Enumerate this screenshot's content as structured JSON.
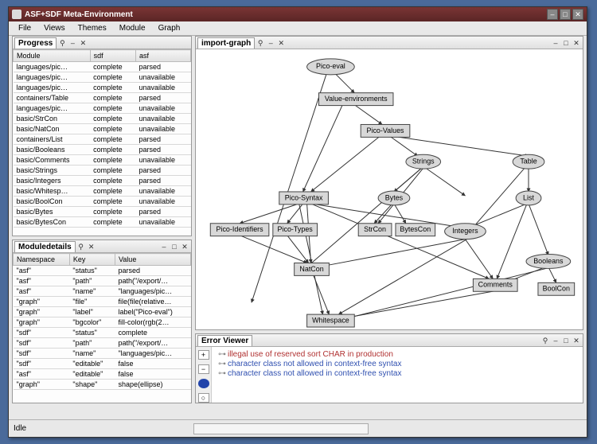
{
  "window": {
    "title": "ASF+SDF Meta-Environment"
  },
  "menu": [
    "File",
    "Views",
    "Themes",
    "Module",
    "Graph"
  ],
  "progress": {
    "title": "Progress",
    "headers": [
      "Module",
      "sdf",
      "asf"
    ],
    "rows": [
      [
        "languages/pic…",
        "complete",
        "parsed"
      ],
      [
        "languages/pic…",
        "complete",
        "unavailable"
      ],
      [
        "languages/pic…",
        "complete",
        "unavailable"
      ],
      [
        "containers/Table",
        "complete",
        "parsed"
      ],
      [
        "languages/pic…",
        "complete",
        "unavailable"
      ],
      [
        "basic/StrCon",
        "complete",
        "unavailable"
      ],
      [
        "basic/NatCon",
        "complete",
        "unavailable"
      ],
      [
        "containers/List",
        "complete",
        "parsed"
      ],
      [
        "basic/Booleans",
        "complete",
        "parsed"
      ],
      [
        "basic/Comments",
        "complete",
        "unavailable"
      ],
      [
        "basic/Strings",
        "complete",
        "parsed"
      ],
      [
        "basic/Integers",
        "complete",
        "parsed"
      ],
      [
        "basic/Whitesp…",
        "complete",
        "unavailable"
      ],
      [
        "basic/BoolCon",
        "complete",
        "unavailable"
      ],
      [
        "basic/Bytes",
        "complete",
        "parsed"
      ],
      [
        "basic/BytesCon",
        "complete",
        "unavailable"
      ]
    ]
  },
  "details": {
    "title": "Moduledetails",
    "headers": [
      "Namespace",
      "Key",
      "Value"
    ],
    "rows": [
      [
        "\"asf\"",
        "\"status\"",
        "parsed"
      ],
      [
        "\"asf\"",
        "\"path\"",
        "path(\"/export/…"
      ],
      [
        "\"asf\"",
        "\"name\"",
        "\"languages/pic…"
      ],
      [
        "\"graph\"",
        "\"file\"",
        "file(file(relative…"
      ],
      [
        "\"graph\"",
        "\"label\"",
        "label(\"Pico-eval\")"
      ],
      [
        "\"graph\"",
        "\"bgcolor\"",
        "fill-color(rgb(2…"
      ],
      [
        "\"sdf\"",
        "\"status\"",
        "complete"
      ],
      [
        "\"sdf\"",
        "\"path\"",
        "path(\"/export/…"
      ],
      [
        "\"sdf\"",
        "\"name\"",
        "\"languages/pic…"
      ],
      [
        "\"sdf\"",
        "\"editable\"",
        "false"
      ],
      [
        "\"asf\"",
        "\"editable\"",
        "false"
      ],
      [
        "\"graph\"",
        "\"shape\"",
        "shape(ellipse)"
      ]
    ]
  },
  "importGraph": {
    "title": "import-graph",
    "nodes": {
      "pico_eval": "Pico-eval",
      "value_env": "Value-environments",
      "pico_values": "Pico-Values",
      "strings": "Strings",
      "table": "Table",
      "pico_syntax": "Pico-Syntax",
      "bytes": "Bytes",
      "list": "List",
      "pico_ident": "Pico-Identifiers",
      "pico_types": "Pico-Types",
      "strcon": "StrCon",
      "bytescon": "BytesCon",
      "integers": "Integers",
      "natcon": "NatCon",
      "booleans": "Booleans",
      "comments": "Comments",
      "boolcon": "BoolCon",
      "whitespace": "Whitespace"
    }
  },
  "errorViewer": {
    "title": "Error Viewer",
    "messages": [
      {
        "cls": "red",
        "text": "illegal use of reserved sort CHAR in production"
      },
      {
        "cls": "blue",
        "text": "character class not allowed in context-free syntax"
      },
      {
        "cls": "blue",
        "text": "character class not allowed in context-free syntax"
      }
    ]
  },
  "status": {
    "text": "Idle"
  },
  "pbtn": {
    "dash": "–",
    "min": "▫",
    "max": "□",
    "close": "✕",
    "pin": "⚲",
    "larr": "◂",
    "rarr": "▸"
  }
}
